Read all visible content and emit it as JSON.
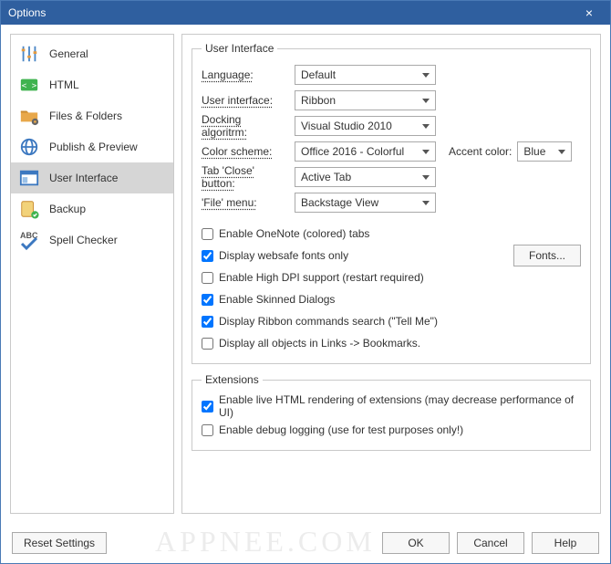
{
  "window": {
    "title": "Options"
  },
  "sidebar": {
    "items": [
      {
        "label": "General"
      },
      {
        "label": "HTML"
      },
      {
        "label": "Files & Folders"
      },
      {
        "label": "Publish & Preview"
      },
      {
        "label": "User Interface"
      },
      {
        "label": "Backup"
      },
      {
        "label": "Spell Checker"
      }
    ]
  },
  "groups": {
    "ui_legend": "User Interface",
    "ext_legend": "Extensions"
  },
  "fields": {
    "language_label": "Language:",
    "language_value": "Default",
    "userinterface_label": "User interface:",
    "userinterface_value": "Ribbon",
    "docking_label": "Docking algoritrm:",
    "docking_value": "Visual Studio 2010",
    "colorscheme_label": "Color scheme:",
    "colorscheme_value": "Office 2016 - Colorful",
    "accent_label": "Accent color:",
    "accent_value": "Blue",
    "tabclose_label": "Tab 'Close' button:",
    "tabclose_value": "Active Tab",
    "filemenu_label": "'File' menu:",
    "filemenu_value": "Backstage View"
  },
  "checks": {
    "onenote": "Enable OneNote (colored) tabs",
    "websafe": "Display websafe fonts only",
    "hidpi": "Enable High DPI support (restart required)",
    "skinned": "Enable Skinned Dialogs",
    "tellme": "Display Ribbon commands search (\"Tell Me\")",
    "linksbm": "Display all objects in Links -> Bookmarks.",
    "ext_live": "Enable live HTML rendering of extensions (may decrease performance of UI)",
    "ext_debug": "Enable debug logging (use for test purposes only!)"
  },
  "buttons": {
    "fonts": "Fonts...",
    "reset": "Reset Settings",
    "ok": "OK",
    "cancel": "Cancel",
    "help": "Help"
  },
  "watermark": "APPNEE.COM"
}
